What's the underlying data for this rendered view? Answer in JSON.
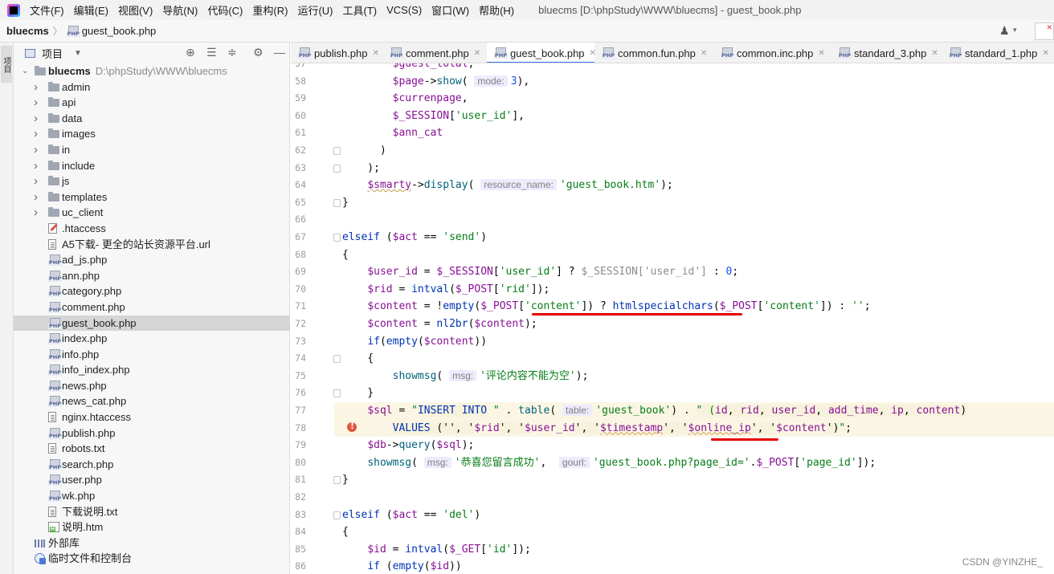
{
  "menubar": {
    "items": [
      "文件(F)",
      "编辑(E)",
      "视图(V)",
      "导航(N)",
      "代码(C)",
      "重构(R)",
      "运行(U)",
      "工具(T)",
      "VCS(S)",
      "窗口(W)",
      "帮助(H)"
    ],
    "window_title": "bluecms [D:\\phpStudy\\WWW\\bluecms] - guest_book.php"
  },
  "navbar": {
    "project": "bluecms",
    "file": "guest_book.php",
    "php_badge": "PHP"
  },
  "toolstrip": {
    "project_label": "项目"
  },
  "panel": {
    "title": "项目",
    "tree": [
      {
        "label": "bluecms",
        "path": "D:\\phpStudy\\WWW\\bluecms",
        "type": "root"
      },
      {
        "label": "admin",
        "type": "folder"
      },
      {
        "label": "api",
        "type": "folder"
      },
      {
        "label": "data",
        "type": "folder"
      },
      {
        "label": "images",
        "type": "folder"
      },
      {
        "label": "in",
        "type": "folder"
      },
      {
        "label": "include",
        "type": "folder"
      },
      {
        "label": "js",
        "type": "folder"
      },
      {
        "label": "templates",
        "type": "folder"
      },
      {
        "label": "uc_client",
        "type": "folder"
      },
      {
        "label": ".htaccess",
        "type": "ht"
      },
      {
        "label": "A5下载- 更全的站长资源平台.url",
        "type": "txt"
      },
      {
        "label": "ad_js.php",
        "type": "php"
      },
      {
        "label": "ann.php",
        "type": "php"
      },
      {
        "label": "category.php",
        "type": "php"
      },
      {
        "label": "comment.php",
        "type": "php"
      },
      {
        "label": "guest_book.php",
        "type": "php",
        "selected": true
      },
      {
        "label": "index.php",
        "type": "php"
      },
      {
        "label": "info.php",
        "type": "php"
      },
      {
        "label": "info_index.php",
        "type": "php"
      },
      {
        "label": "news.php",
        "type": "php"
      },
      {
        "label": "news_cat.php",
        "type": "php"
      },
      {
        "label": "nginx.htaccess",
        "type": "txt"
      },
      {
        "label": "publish.php",
        "type": "php"
      },
      {
        "label": "robots.txt",
        "type": "txt"
      },
      {
        "label": "search.php",
        "type": "php"
      },
      {
        "label": "user.php",
        "type": "php"
      },
      {
        "label": "wk.php",
        "type": "php"
      },
      {
        "label": "下载说明.txt",
        "type": "txt"
      },
      {
        "label": "说明.htm",
        "type": "htm"
      },
      {
        "label": "外部库",
        "type": "lib"
      },
      {
        "label": "临时文件和控制台",
        "type": "console"
      }
    ]
  },
  "tabs": [
    {
      "label": "publish.php",
      "active": false
    },
    {
      "label": "comment.php",
      "active": false
    },
    {
      "label": "guest_book.php",
      "active": true
    },
    {
      "label": "common.fun.php",
      "active": false
    },
    {
      "label": "common.inc.php",
      "active": false
    },
    {
      "label": "standard_3.php",
      "active": false
    },
    {
      "label": "standard_1.php",
      "active": false
    }
  ],
  "editor": {
    "line_numbers": [
      "57",
      "58",
      "59",
      "60",
      "61",
      "62",
      "63",
      "64",
      "65",
      "66",
      "67",
      "68",
      "69",
      "70",
      "71",
      "72",
      "73",
      "74",
      "75",
      "76",
      "77",
      "78",
      "79",
      "80",
      "81",
      "82",
      "83",
      "84",
      "85",
      "86"
    ],
    "hints": {
      "mode": "mode:",
      "resource_name": "resource_name:",
      "msg": "msg:",
      "table": "table:",
      "gourl": "gourl:"
    },
    "strings": {
      "guest_book_htm": "'guest_book.htm'",
      "send": "'send'",
      "user_id_key": "'user_id'",
      "rid_key": "'rid'",
      "content_key": "'content'",
      "empty_str": "''",
      "msg_empty": "'评论内容不能为空'",
      "table_name": "'guest_book'",
      "msg_ok": "'恭喜您留言成功'",
      "gourl": "'guest_book.php?page_id='",
      "page_id_key": "'page_id'",
      "del": "'del'",
      "id_key": "'id'"
    }
  },
  "watermark": "CSDN @YINZHE_"
}
